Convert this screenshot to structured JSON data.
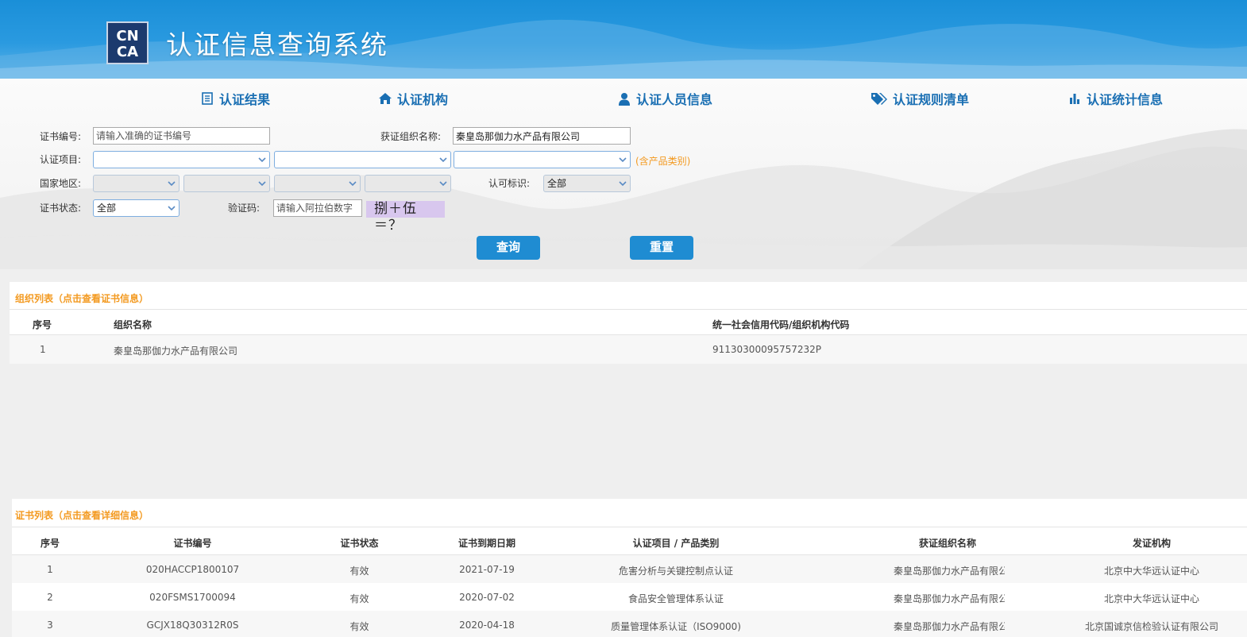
{
  "header": {
    "logo_text": "CNCA",
    "title": "认证信息查询系统"
  },
  "nav": [
    {
      "label": "认证结果",
      "icon": "list-icon"
    },
    {
      "label": "认证机构",
      "icon": "home-icon"
    },
    {
      "label": "认证人员信息",
      "icon": "user-icon"
    },
    {
      "label": "认证规则清单",
      "icon": "tags-icon"
    },
    {
      "label": "认证统计信息",
      "icon": "bar-chart-icon"
    }
  ],
  "form": {
    "cert_no_label": "证书编号:",
    "cert_no_placeholder": "请输入准确的证书编号",
    "org_label": "获证组织名称:",
    "org_value": "秦皇岛那伽力水产品有限公司",
    "project_label": "认证项目:",
    "product_note": "(含产品类别)",
    "region_label": "国家地区:",
    "accred_label": "认可标识:",
    "accred_value": "全部",
    "status_label": "证书状态:",
    "status_value": "全部",
    "captcha_label": "验证码:",
    "captcha_placeholder": "请输入阿拉伯数字",
    "captcha_text": "捌＋伍＝？",
    "query_button": "查询",
    "reset_button": "重置"
  },
  "org_list": {
    "title": "组织列表（点击查看证书信息）",
    "columns": [
      "序号",
      "组织名称",
      "统一社会信用代码/组织机构代码"
    ],
    "rows": [
      [
        "1",
        "秦皇岛那伽力水产品有限公司",
        "91130300095757232P"
      ]
    ]
  },
  "cert_list": {
    "title": "证书列表（点击查看详细信息）",
    "columns": [
      "序号",
      "证书编号",
      "证书状态",
      "证书到期日期",
      "认证项目 / 产品类别",
      "获证组织名称",
      "发证机构"
    ],
    "rows": [
      [
        "1",
        "020HACCP1800107",
        "有效",
        "2021-07-19",
        "危害分析与关键控制点认证",
        "秦皇岛那伽力水产品有限公",
        "北京中大华远认证中心"
      ],
      [
        "2",
        "020FSMS1700094",
        "有效",
        "2020-07-02",
        "食品安全管理体系认证",
        "秦皇岛那伽力水产品有限公",
        "北京中大华远认证中心"
      ],
      [
        "3",
        "GCJX18Q30312R0S",
        "有效",
        "2020-04-18",
        "质量管理体系认证（ISO9000)",
        "秦皇岛那伽力水产品有限公",
        "北京国诚京信检验认证有限公司"
      ]
    ]
  },
  "colors": {
    "header_blue": "#1a8fd8",
    "nav_blue": "#1a6fb3",
    "button_blue": "#1f8cd2",
    "accent_orange": "#f39a21"
  }
}
